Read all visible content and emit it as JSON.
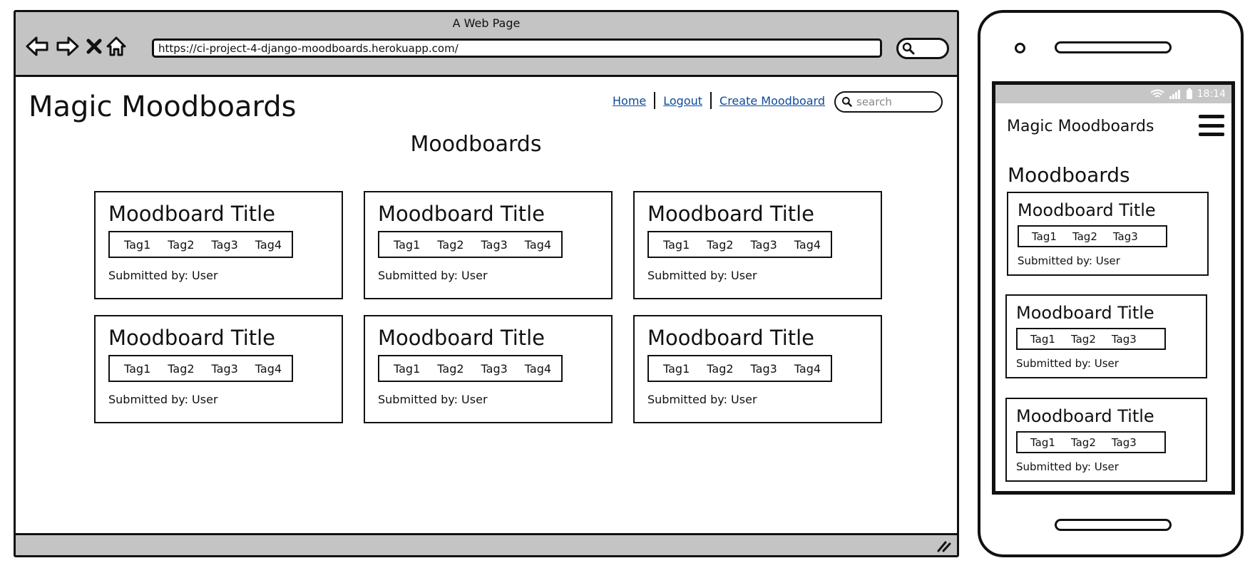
{
  "browser": {
    "window_title": "A Web Page",
    "url": "https://ci-project-4-django-moodboards.herokuapp.com/"
  },
  "site": {
    "title": "Magic Moodboards",
    "nav": [
      {
        "label": "Home"
      },
      {
        "label": "Logout"
      },
      {
        "label": "Create Moodboard"
      }
    ],
    "search_placeholder": "search",
    "heading": "Moodboards",
    "cards": [
      {
        "title": "Moodboard Title",
        "tags": [
          "Tag1",
          "Tag2",
          "Tag3",
          "Tag4"
        ],
        "submitted": "Submitted by: User"
      },
      {
        "title": "Moodboard Title",
        "tags": [
          "Tag1",
          "Tag2",
          "Tag3",
          "Tag4"
        ],
        "submitted": "Submitted by: User"
      },
      {
        "title": "Moodboard Title",
        "tags": [
          "Tag1",
          "Tag2",
          "Tag3",
          "Tag4"
        ],
        "submitted": "Submitted by: User"
      },
      {
        "title": "Moodboard Title",
        "tags": [
          "Tag1",
          "Tag2",
          "Tag3",
          "Tag4"
        ],
        "submitted": "Submitted by: User"
      },
      {
        "title": "Moodboard Title",
        "tags": [
          "Tag1",
          "Tag2",
          "Tag3",
          "Tag4"
        ],
        "submitted": "Submitted by: User"
      },
      {
        "title": "Moodboard Title",
        "tags": [
          "Tag1",
          "Tag2",
          "Tag3",
          "Tag4"
        ],
        "submitted": "Submitted by: User"
      }
    ]
  },
  "mobile": {
    "status_time": "18:14",
    "title": "Magic Moodboards",
    "heading": "Moodboards",
    "cards": [
      {
        "title": "Moodboard Title",
        "tags": [
          "Tag1",
          "Tag2",
          "Tag3"
        ],
        "submitted": "Submitted by: User"
      },
      {
        "title": "Moodboard Title",
        "tags": [
          "Tag1",
          "Tag2",
          "Tag3"
        ],
        "submitted": "Submitted by: User"
      },
      {
        "title": "Moodboard Title",
        "tags": [
          "Tag1",
          "Tag2",
          "Tag3"
        ],
        "submitted": "Submitted by: User"
      }
    ]
  },
  "colors": {
    "link": "#0b4a9c",
    "chrome": "#c4c4c4",
    "status_bar": "#c6c6c6"
  }
}
